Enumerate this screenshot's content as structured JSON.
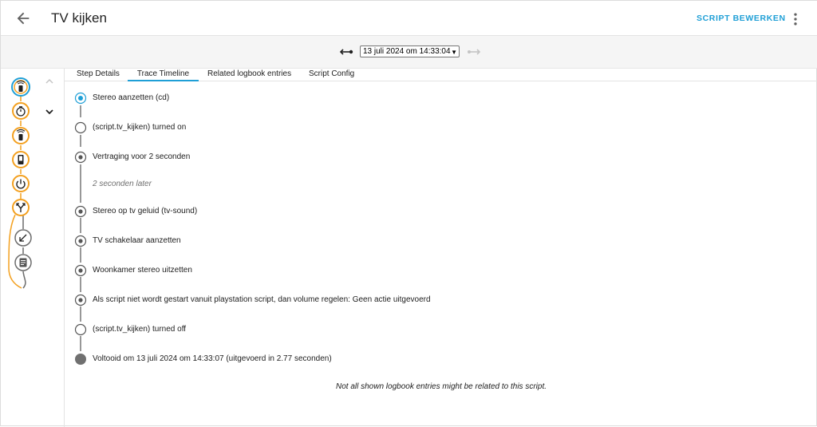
{
  "header": {
    "title": "TV kijken",
    "edit_label": "SCRIPT BEWERKEN",
    "back_icon": "arrow-left-icon",
    "more_icon": "dots-vertical-icon"
  },
  "trace_selector": {
    "selected": "13 juli 2024 om 14:33:04"
  },
  "tabs": [
    {
      "label": "Step Details"
    },
    {
      "label": "Trace Timeline",
      "active": true
    },
    {
      "label": "Related logbook entries"
    },
    {
      "label": "Script Config"
    }
  ],
  "graph_nodes": [
    {
      "icon": "remote-icon",
      "state": "selected"
    },
    {
      "icon": "timer-icon",
      "state": "executed"
    },
    {
      "icon": "remote-icon",
      "state": "executed"
    },
    {
      "icon": "device-icon",
      "state": "executed"
    },
    {
      "icon": "power-icon",
      "state": "executed"
    },
    {
      "icon": "call-split-icon",
      "state": "executed"
    },
    {
      "icon": "arrow-bottom-left-icon",
      "state": "skipped"
    },
    {
      "icon": "script-text-icon",
      "state": "skipped"
    }
  ],
  "timeline": [
    {
      "text": "Stereo aanzetten (cd)",
      "marker": "selected"
    },
    {
      "text": "(script.tv_kijken) turned on",
      "marker": "open"
    },
    {
      "text": "Vertraging voor 2 seconden",
      "marker": "dot"
    },
    {
      "text": "2 seconden later",
      "marker": "none"
    },
    {
      "text": "Stereo op tv geluid (tv-sound)",
      "marker": "dot"
    },
    {
      "text": "TV schakelaar aanzetten",
      "marker": "dot"
    },
    {
      "text": "Woonkamer stereo uitzetten",
      "marker": "dot"
    },
    {
      "text": "Als script niet wordt gestart vanuit playstation script, dan volume regelen: Geen actie uitgevoerd",
      "marker": "dot"
    },
    {
      "text": "(script.tv_kijken) turned off",
      "marker": "open"
    },
    {
      "text": "Voltooid om 13 juli 2024 om 14:33:07 (uitgevoerd in 2.77 seconden)",
      "marker": "filled"
    }
  ],
  "note": "Not all shown logbook entries might be related to this script.",
  "colors": {
    "accent": "#1f9fd6",
    "executed": "#f3a01f",
    "skipped": "#6c6c6c"
  }
}
